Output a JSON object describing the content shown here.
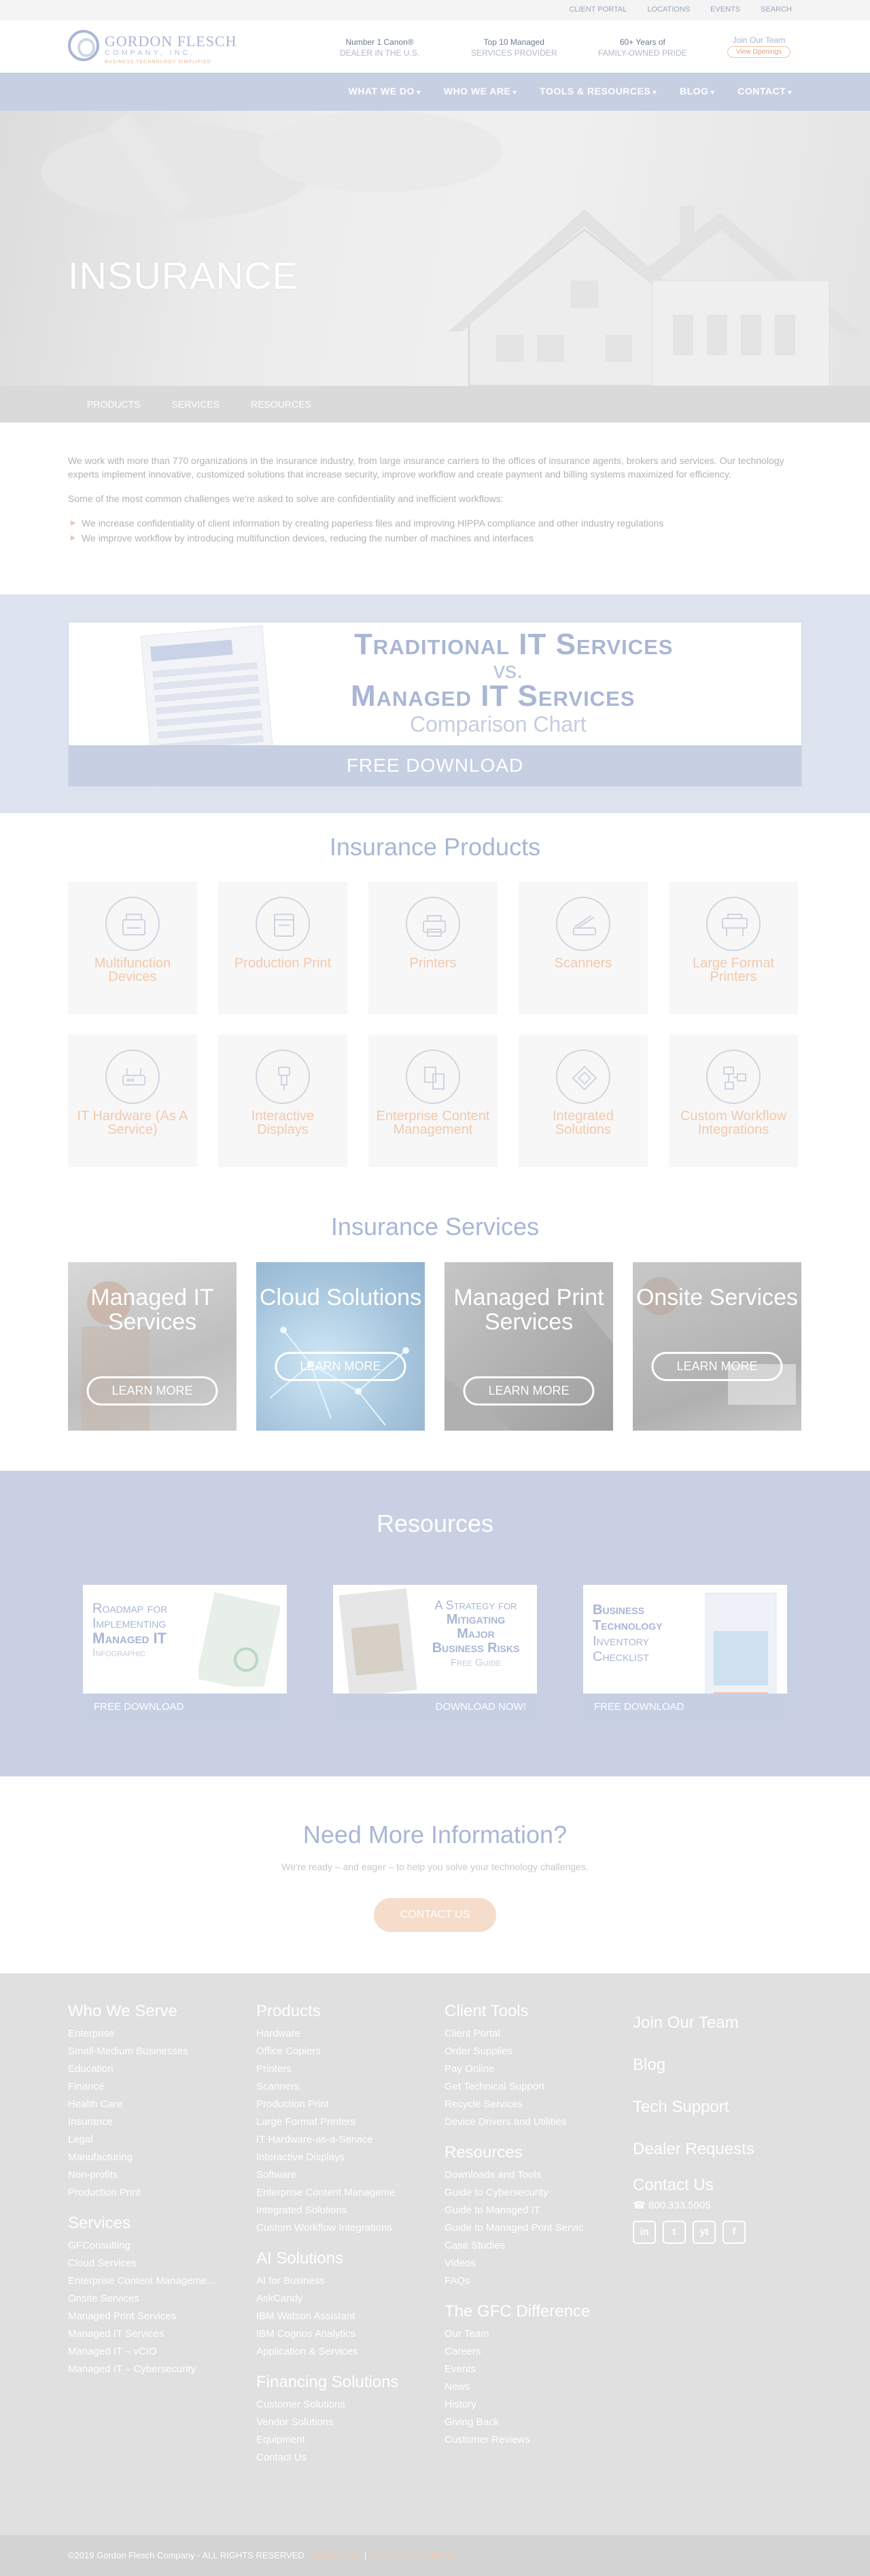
{
  "utility_nav": [
    "CLIENT PORTAL",
    "LOCATIONS",
    "EVENTS",
    "SEARCH"
  ],
  "logo": {
    "line1": "GORDON FLESCH",
    "line2": "COMPANY, INC.",
    "line3": "BUSINESS TECHNOLOGY SIMPLIFIED"
  },
  "header_stats": [
    {
      "a": "Number 1 Canon®",
      "b": "DEALER IN THE U.S."
    },
    {
      "a": "Top 10 Managed",
      "b": "SERVICES PROVIDER"
    },
    {
      "a": "60+ Years of",
      "b": "FAMILY-OWNED PRIDE"
    }
  ],
  "join": {
    "title": "Join Our Team",
    "button": "View Openings"
  },
  "main_nav": [
    "WHAT WE DO",
    "WHO WE ARE",
    "TOOLS & RESOURCES",
    "BLOG",
    "CONTACT"
  ],
  "hero": {
    "title": "INSURANCE"
  },
  "sub_nav": [
    "PRODUCTS",
    "SERVICES",
    "RESOURCES"
  ],
  "intro": {
    "p1": "We work with more than 770 organizations in the insurance industry, from large insurance carriers to the offices of insurance agents, brokers and services. Our technology experts implement innovative, customized solutions that increase security, improve workflow and create payment and billing systems maximized for efficiency.",
    "p2": "Some of the most common challenges we're asked to solve are confidentiality and inefficient workflows:",
    "bullets": [
      "We increase confidentiality of client information by creating paperless files and improving HIPPA compliance and other industry regulations",
      "We improve workflow by introducing multifunction devices, reducing the number of machines and interfaces"
    ]
  },
  "banner": {
    "line1": "Traditional IT Services",
    "line2": "vs.",
    "line3": "Managed IT Services",
    "line4": "Comparison Chart",
    "cta": "FREE DOWNLOAD"
  },
  "products": {
    "title": "Insurance Products",
    "items": [
      {
        "label": "Multifunction Devices",
        "icon": "mfp-icon"
      },
      {
        "label": "Production Print",
        "icon": "production-printer-icon"
      },
      {
        "label": "Printers",
        "icon": "printer-icon"
      },
      {
        "label": "Scanners",
        "icon": "scanner-icon"
      },
      {
        "label": "Large Format Printers",
        "icon": "large-format-printer-icon"
      },
      {
        "label": "IT Hardware (As A Service)",
        "icon": "router-icon"
      },
      {
        "label": "Interactive Displays",
        "icon": "usb-display-icon"
      },
      {
        "label": "Enterprise Content Management",
        "icon": "documents-icon"
      },
      {
        "label": "Integrated Solutions",
        "icon": "puzzle-icon"
      },
      {
        "label": "Custom Workflow Integrations",
        "icon": "workflow-icon"
      }
    ]
  },
  "services": {
    "title": "Insurance Services",
    "items": [
      {
        "title": "Managed IT Services",
        "button": "LEARN MORE"
      },
      {
        "title": "Cloud Solutions",
        "button": "LEARN MORE"
      },
      {
        "title": "Managed Print Services",
        "button": "LEARN MORE"
      },
      {
        "title": "Onsite Services",
        "button": "LEARN MORE"
      }
    ]
  },
  "resources": {
    "title": "Resources",
    "items": [
      {
        "l1": "Roadmap for",
        "l2": "Implementing",
        "l3": "Managed IT",
        "l4": "Infographic",
        "cta": "FREE DOWNLOAD"
      },
      {
        "l1": "A Strategy for",
        "l2": "Mitigating",
        "l3": "Major",
        "l4": "Business Risks",
        "l5": "Free Guide",
        "cta": "DOWNLOAD NOW!"
      },
      {
        "l1": "Business",
        "l2": "Technology",
        "l3": "Inventory",
        "l4": "Checklist",
        "cta": "FREE DOWNLOAD"
      }
    ]
  },
  "need_more": {
    "title": "Need More Information?",
    "subtitle": "We're ready – and eager – to help you solve your technology challenges.",
    "button": "CONTACT US"
  },
  "footer": {
    "who_we_serve": {
      "title": "Who We Serve",
      "items": [
        "Enterprise",
        "Small-Medium Businesses",
        "Education",
        "Finance",
        "Health Care",
        "Insurance",
        "Legal",
        "Manufacturing",
        "Non-profits",
        "Production Print"
      ]
    },
    "services": {
      "title": "Services",
      "items": [
        "GFConsulting",
        "Cloud Services",
        "Enterprise Content Manageme...",
        "Onsite Services",
        "Managed Print Services",
        "Managed IT Services",
        "Managed IT – vCIO",
        "Managed IT – Cybersecurity"
      ]
    },
    "products": {
      "title": "Products",
      "items": [
        "Hardware",
        "Office Copiers",
        "Printers",
        "Scanners",
        "Production Print",
        "Large Format Printers",
        "IT Hardware-as-a-Service",
        "Interactive Displays",
        "Software",
        "Enterprise Content Manageme",
        "Integrated Solutions",
        "Custom Workflow Integrations"
      ]
    },
    "ai_solutions": {
      "title": "AI Solutions",
      "items": [
        "AI for Business",
        "AskCandy",
        "IBM Watson Assistant",
        "IBM Cognos Analytics",
        "Application & Services"
      ]
    },
    "financing": {
      "title": "Financing Solutions",
      "items": [
        "Customer Solutions",
        "Vendor Solutions",
        "Equipment",
        "Contact Us"
      ]
    },
    "client_tools": {
      "title": "Client Tools",
      "items": [
        "Client Portal",
        "Order Supplies",
        "Pay Online",
        "Get Technical Support",
        "Recycle Services",
        "Device Drivers and Utilities"
      ]
    },
    "resources": {
      "title": "Resources",
      "items": [
        "Downloads and Tools",
        "Guide to Cybersecurity",
        "Guide to Managed IT",
        "Guide to Managed Print Servic",
        "Case Studies",
        "Videos",
        "FAQs"
      ]
    },
    "gfc_difference": {
      "title": "The GFC Difference",
      "items": [
        "Our Team",
        "Careers",
        "Events",
        "News",
        "History",
        "Giving Back",
        "Customer Reviews"
      ]
    },
    "right_links": [
      "Join Our Team",
      "Blog",
      "Tech Support",
      "Dealer Requests"
    ],
    "contact": {
      "title": "Contact Us",
      "phone": "800.333.5905"
    },
    "social": [
      "in",
      "t",
      "yt",
      "f"
    ]
  },
  "copyright": {
    "text": "©2019 Gordon Flesch Company - ALL RIGHTS RESERVED",
    "link1": "Privacy Policy",
    "sep": "|",
    "link2": "Terms and Conditions"
  }
}
